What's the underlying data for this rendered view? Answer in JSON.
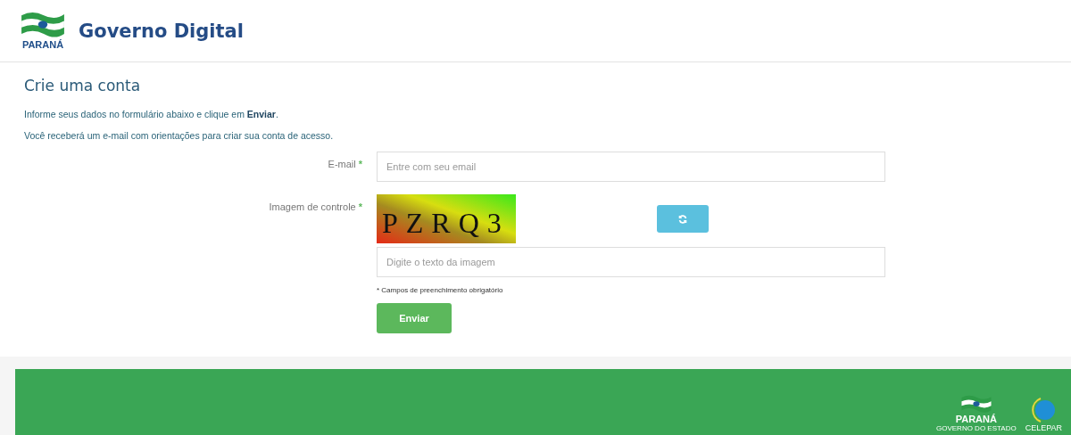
{
  "header": {
    "brand_state": "PARANÁ",
    "title": "Governo Digital"
  },
  "page": {
    "heading": "Crie uma conta",
    "intro": "Informe seus dados no formulário abaixo e clique em **Enviar**.",
    "note": "Você receberá um e-mail com orientações para criar sua conta de acesso."
  },
  "form": {
    "fields": [
      {
        "label": "E-mail",
        "required_mark": "*",
        "placeholder": "Entre com seu email"
      }
    ],
    "captcha": {
      "label": "Imagem de controle",
      "required_mark": "*",
      "text": "PZRQ3",
      "placeholder": "Digite o texto da imagem"
    },
    "required_note": "* Campos de preenchimento obrigatório",
    "submit": "Enviar"
  },
  "footer": {
    "state_name": "PARANÁ",
    "state_sub": "GOVERNO DO ESTADO",
    "company": "CELEPAR"
  }
}
